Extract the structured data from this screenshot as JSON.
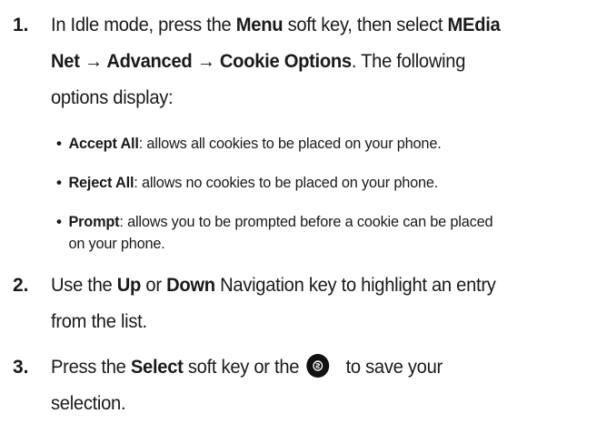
{
  "steps": [
    {
      "number": "1.",
      "lines": [
        [
          "In Idle mode, press the ",
          "Menu",
          " soft key, then select ",
          "MEdia"
        ],
        [
          "Net → Advanced → Cookie Options",
          ". The following"
        ],
        [
          "options display:"
        ]
      ]
    },
    {
      "number": "2.",
      "lines": [
        [
          "Use the ",
          "Up",
          " or ",
          "Down",
          " Navigation key to highlight an entry"
        ],
        [
          "from the list."
        ]
      ]
    },
    {
      "number": "3.",
      "lines": [
        [
          "Press the ",
          "Select",
          " soft key or the",
          " to save your"
        ],
        [
          "selection."
        ]
      ]
    }
  ],
  "options": [
    {
      "label": "Accept All",
      "desc": ": allows all cookies to be placed on your phone."
    },
    {
      "label": "Reject All",
      "desc": ": allows no cookies to be placed on your phone."
    },
    {
      "label": "Prompt",
      "desc": ": allows you to be prompted before a cookie can be placed",
      "desc2": "on your phone."
    }
  ],
  "bullet": "•",
  "icons": {
    "select_key": "select-key-icon"
  }
}
